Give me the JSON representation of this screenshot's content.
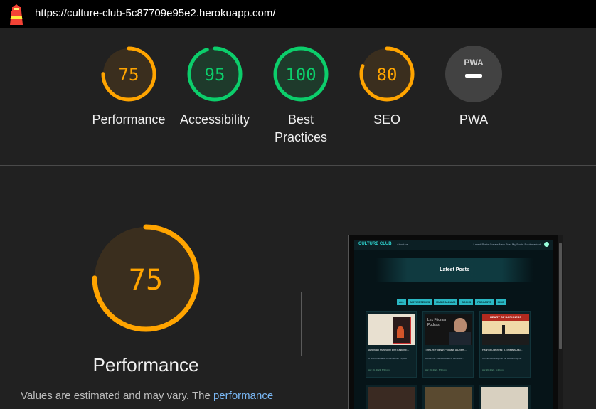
{
  "url": "https://culture-club-5c87709e95e2.herokuapp.com/",
  "colors": {
    "average": "#ffa400",
    "average_bg": "#3a2e1e",
    "pass": "#0cce6b",
    "pass_bg": "#1e3a2b",
    "pwa_bg": "#424242"
  },
  "categories": [
    {
      "score": "75",
      "label": "Performance",
      "status": "average"
    },
    {
      "score": "95",
      "label": "Accessibility",
      "status": "pass"
    },
    {
      "score": "100",
      "label": "Best Practices",
      "status": "pass"
    },
    {
      "score": "80",
      "label": "SEO",
      "status": "average"
    },
    {
      "score": "",
      "label": "PWA",
      "status": "pwa",
      "badge": "PWA"
    }
  ],
  "performance": {
    "score": "75",
    "title": "Performance",
    "note_prefix": "Values are estimated and may vary. The ",
    "note_link": "performance"
  },
  "screenshot": {
    "brand": "CULTURE CLUB",
    "about": "About us",
    "nav_links": "Latest Posts   Create New Post   My Posts   Bookmarked",
    "hero_title": "Latest Posts",
    "filters": [
      "ALL",
      "MOVIES/SERIES",
      "MUSIC ALBUMS",
      "BOOKS",
      "PODCASTS",
      "MISC"
    ],
    "cards": [
      {
        "caption": "American Psycho by Bret Easton E...",
        "desc": "A Wild Exploration of the Human Psyche",
        "meta": "Apr 19, 2024, 6:50 pm"
      },
      {
        "caption": "The Lex Fridman Podcast: A Divers...",
        "desc": "A Dive into The Multitudes of Lex vices...",
        "meta": "Apr 19, 2024, 6:50 pm"
      },
      {
        "caption": "Heart of Darkness: A Timeless Jou...",
        "desc": "Conrad's Journey into the Human Psyche",
        "meta": "Apr 19, 2024, 6:48 pm"
      }
    ],
    "card_art": [
      "",
      "Lex Fridman Podcast",
      "HEART OF DARKNESS"
    ]
  }
}
